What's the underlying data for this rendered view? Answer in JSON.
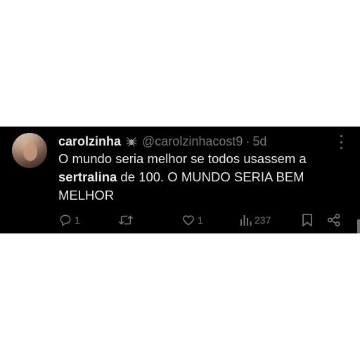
{
  "tweet": {
    "display_name": "carolzinha",
    "badge_icon": "spider-icon",
    "handle": "@carolzinhacost9",
    "separator": "·",
    "time": "5d",
    "text_line1": "O mundo seria melhor se todos usassem a",
    "text_bold": "sertralina",
    "text_rest": " de 100. O MUNDO SERIA BEM MELHOR",
    "colors": {
      "background": "#000000",
      "primary_text": "#e7e9ea",
      "secondary_text": "#71767b"
    }
  },
  "actions": {
    "reply_count": "1",
    "retweet_count": "",
    "like_count": "1",
    "views_count": "237"
  }
}
